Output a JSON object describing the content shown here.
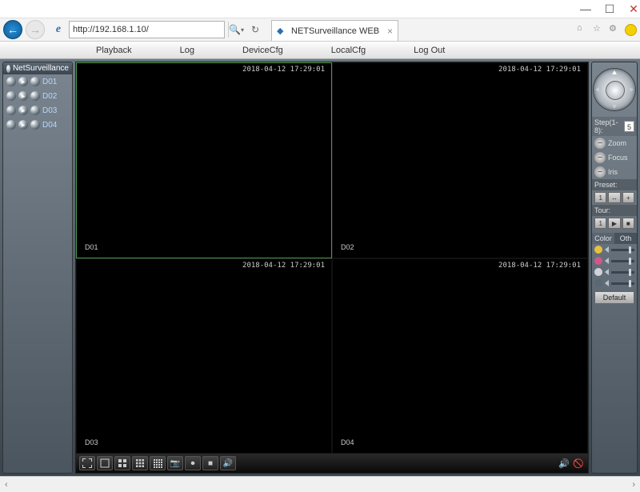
{
  "window": {
    "min": "—",
    "max": "☐",
    "close": "✕"
  },
  "browser": {
    "url": "http://192.168.1.10/",
    "search_glyph": "🔍",
    "refresh_glyph": "↻",
    "tab_title": "NETSurveillance WEB",
    "tab_close": "×"
  },
  "menu": {
    "items": [
      "Playback",
      "Log",
      "DeviceCfg",
      "LocalCfg",
      "Log Out"
    ]
  },
  "sidebar": {
    "title": "NetSurveillance",
    "channels": [
      {
        "name": "D01"
      },
      {
        "name": "D02"
      },
      {
        "name": "D03"
      },
      {
        "name": "D04"
      }
    ]
  },
  "cameras": [
    {
      "label": "D01",
      "timestamp": "2018-04-12 17:29:01",
      "active": true
    },
    {
      "label": "D02",
      "timestamp": "2018-04-12 17:29:01",
      "active": false
    },
    {
      "label": "D03",
      "timestamp": "2018-04-12 17:29:01",
      "active": false
    },
    {
      "label": "D04",
      "timestamp": "2018-04-12 17:29:01",
      "active": false
    }
  ],
  "ptz": {
    "step_label": "Step(1-8):",
    "step_value": "5",
    "zoom_label": "Zoom",
    "focus_label": "Focus",
    "iris_label": "Iris",
    "preset_label": "Preset:",
    "preset_value": "1",
    "tour_label": "Tour:",
    "tour_value": "1",
    "color_tab": "Color",
    "other_tab": "Oth",
    "default_btn": "Default",
    "sliders": [
      {
        "color": "#e8c040"
      },
      {
        "color": "#d05888"
      },
      {
        "color": "#d0d4d8"
      },
      {
        "color": "#5a6874"
      }
    ]
  }
}
